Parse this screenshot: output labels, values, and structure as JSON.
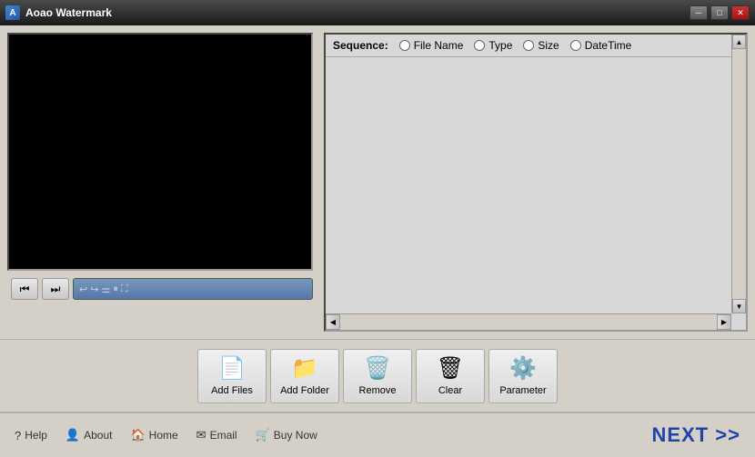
{
  "app": {
    "title": "Aoao Watermark",
    "icon": "A"
  },
  "titlebar": {
    "minimize_label": "─",
    "maximize_label": "□",
    "close_label": "✕"
  },
  "sequence": {
    "label": "Sequence:",
    "options": [
      "File Name",
      "Type",
      "Size",
      "DateTime"
    ]
  },
  "toolbar": {
    "add_files_label": "Add Files",
    "add_folder_label": "Add Folder",
    "remove_label": "Remove",
    "clear_label": "Clear",
    "parameter_label": "Parameter"
  },
  "bottom": {
    "help_label": "Help",
    "about_label": "About",
    "home_label": "Home",
    "email_label": "Email",
    "buynow_label": "Buy Now",
    "next_label": "NEXT >>"
  },
  "controls": {
    "prev_icon": "⏮",
    "next_icon": "⏭",
    "scroll_left": "◀",
    "scroll_right": "▶",
    "scroll_up": "▲",
    "scroll_down": "▼"
  }
}
